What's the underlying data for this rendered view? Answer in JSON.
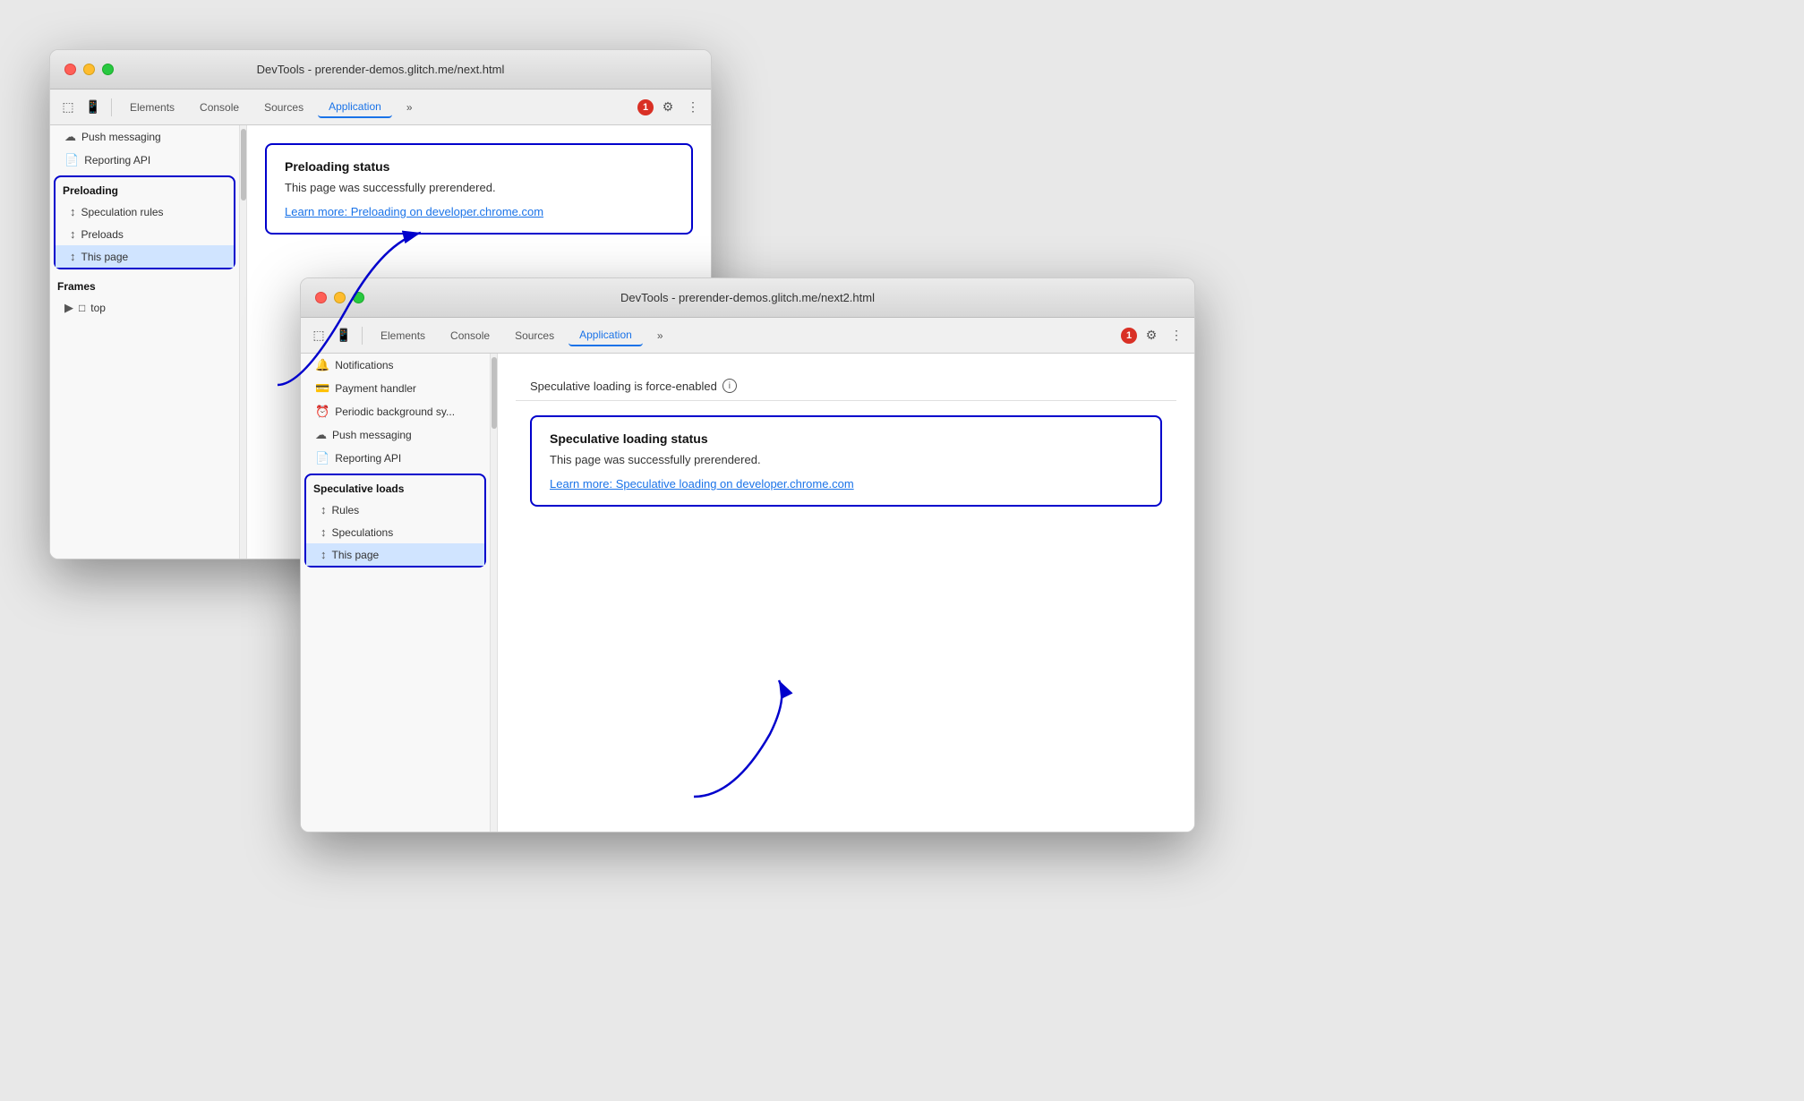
{
  "window1": {
    "title": "DevTools - prerender-demos.glitch.me/next.html",
    "tabs": [
      "Elements",
      "Console",
      "Sources",
      "Application"
    ],
    "active_tab": "Application",
    "toolbar": {
      "error_count": "1"
    },
    "sidebar": {
      "sections": [
        {
          "name": "",
          "items": [
            {
              "icon": "☁",
              "label": "Push messaging"
            },
            {
              "icon": "📄",
              "label": "Reporting API"
            }
          ]
        },
        {
          "name": "Preloading",
          "highlighted": true,
          "items": [
            {
              "icon": "↕",
              "label": "Speculation rules"
            },
            {
              "icon": "↕",
              "label": "Preloads"
            },
            {
              "icon": "↕",
              "label": "This page",
              "selected": true
            }
          ]
        },
        {
          "name": "Frames",
          "items": [
            {
              "icon": "▶",
              "label": "top",
              "folder": true
            }
          ]
        }
      ]
    },
    "main": {
      "status_box": {
        "title": "Preloading status",
        "text": "This page was successfully prerendered.",
        "link": "Learn more: Preloading on developer.chrome.com"
      }
    }
  },
  "window2": {
    "title": "DevTools - prerender-demos.glitch.me/next2.html",
    "tabs": [
      "Elements",
      "Console",
      "Sources",
      "Application"
    ],
    "active_tab": "Application",
    "toolbar": {
      "error_count": "1"
    },
    "sidebar": {
      "sections": [
        {
          "name": "",
          "items": [
            {
              "icon": "🔔",
              "label": "Notifications"
            },
            {
              "icon": "💳",
              "label": "Payment handler"
            },
            {
              "icon": "⏰",
              "label": "Periodic background sy..."
            },
            {
              "icon": "☁",
              "label": "Push messaging"
            },
            {
              "icon": "📄",
              "label": "Reporting API"
            }
          ]
        },
        {
          "name": "Speculative loads",
          "highlighted": true,
          "items": [
            {
              "icon": "↕",
              "label": "Rules"
            },
            {
              "icon": "↕",
              "label": "Speculations"
            },
            {
              "icon": "↕",
              "label": "This page",
              "selected": true
            }
          ]
        }
      ]
    },
    "main": {
      "force_enabled_text": "Speculative loading is force-enabled",
      "status_box": {
        "title": "Speculative loading status",
        "text": "This page was successfully prerendered.",
        "link": "Learn more: Speculative loading on developer.chrome.com"
      }
    }
  },
  "icons": {
    "inspect": "⬚",
    "device": "📱",
    "more": "⋮",
    "settings": "⚙",
    "chevron_more": "»"
  }
}
